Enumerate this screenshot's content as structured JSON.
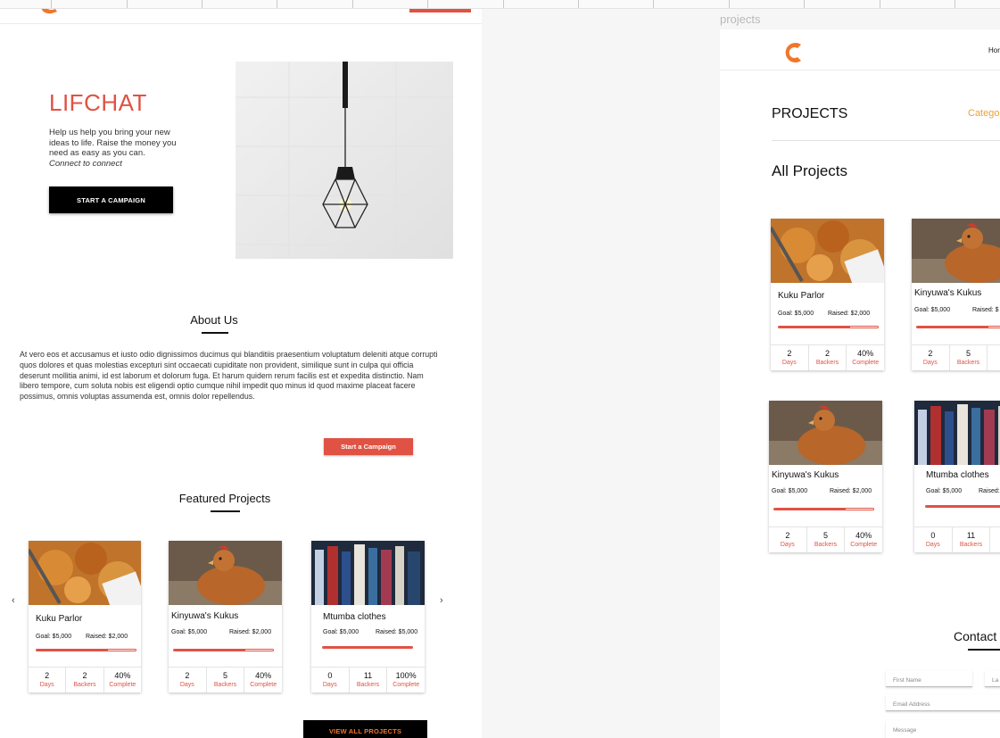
{
  "left_page": {
    "hero": {
      "title": "LIFCHAT",
      "text": "Help us help you bring your new ideas to life. Raise the money you need as easy as you can.",
      "tagline": "Connect to connect",
      "cta": "START A CAMPAIGN"
    },
    "about": {
      "heading": "About Us",
      "body": "At vero eos et accusamus et iusto odio dignissimos ducimus qui blanditiis praesentium voluptatum deleniti atque corrupti quos dolores et quas molestias excepturi sint occaecati cupiditate non provident, similique sunt in culpa qui officia deserunt mollitia animi, id est laborum et dolorum fuga. Et harum quidem rerum facilis est et expedita distinctio. Nam libero tempore, cum soluta nobis est eligendi optio cumque nihil impedit quo minus id quod maxime placeat facere possimus, omnis voluptas assumenda est, omnis dolor repellendus.",
      "cta": "Start a Campaign"
    },
    "featured": {
      "heading": "Featured Projects",
      "prev": "‹",
      "next": "›",
      "cards": [
        {
          "name": "Kuku Parlor",
          "goal": "Goal: $5,000",
          "raised": "Raised: $2,000",
          "progress": 0.72,
          "days": "2",
          "days_label": "Days",
          "backers": "2",
          "backers_label": "Backers",
          "complete": "40%",
          "complete_label": "Complete"
        },
        {
          "name": "Kinyuwa's Kukus",
          "goal": "Goal: $5,000",
          "raised": "Raised: $2,000",
          "progress": 0.72,
          "days": "2",
          "days_label": "Days",
          "backers": "5",
          "backers_label": "Backers",
          "complete": "40%",
          "complete_label": "Complete"
        },
        {
          "name": "Mtumba clothes",
          "goal": "Goal: $5,000",
          "raised": "Raised: $5,000",
          "progress": 1.0,
          "days": "0",
          "days_label": "Days",
          "backers": "11",
          "backers_label": "Backers",
          "complete": "100%",
          "complete_label": "Complete"
        }
      ],
      "view_all": "VIEW ALL PROJECTS"
    }
  },
  "right_page": {
    "artboard_label": "projects",
    "nav_partial": "Hor",
    "heading": "PROJECTS",
    "category_partial": "Catego",
    "subheading": "All Projects",
    "cards": [
      {
        "name": "Kuku Parlor",
        "goal": "Goal: $5,000",
        "raised": "Raised: $2,000",
        "progress": 0.72,
        "days": "2",
        "days_label": "Days",
        "backers": "2",
        "backers_label": "Backers",
        "complete": "40%",
        "complete_label": "Complete"
      },
      {
        "name": "Kinyuwa's Kukus",
        "goal": "Goal: $5,000",
        "raised": "Raised: $",
        "progress": 0.72,
        "days": "2",
        "days_label": "Days",
        "backers": "5",
        "backers_label": "Backers",
        "complete": "4",
        "complete_label": "Co"
      },
      {
        "name": "Kinyuwa's Kukus",
        "goal": "Goal: $5,000",
        "raised": "Raised: $2,000",
        "progress": 0.72,
        "days": "2",
        "days_label": "Days",
        "backers": "5",
        "backers_label": "Backers",
        "complete": "40%",
        "complete_label": "Complete"
      },
      {
        "name": "Mtumba clothes",
        "goal": "Goal: $5,000",
        "raised": "Raised:",
        "progress": 1.0,
        "days": "0",
        "days_label": "Days",
        "backers": "11",
        "backers_label": "Backers",
        "complete": "1",
        "complete_label": "Co"
      }
    ],
    "contact": {
      "heading": "Contact",
      "first_name": "First Name",
      "last_name_partial": "La",
      "email": "Email Address",
      "message": "Message"
    }
  },
  "colors": {
    "accent": "#e05243",
    "logo": "#f0762b",
    "dark": "#000000"
  }
}
